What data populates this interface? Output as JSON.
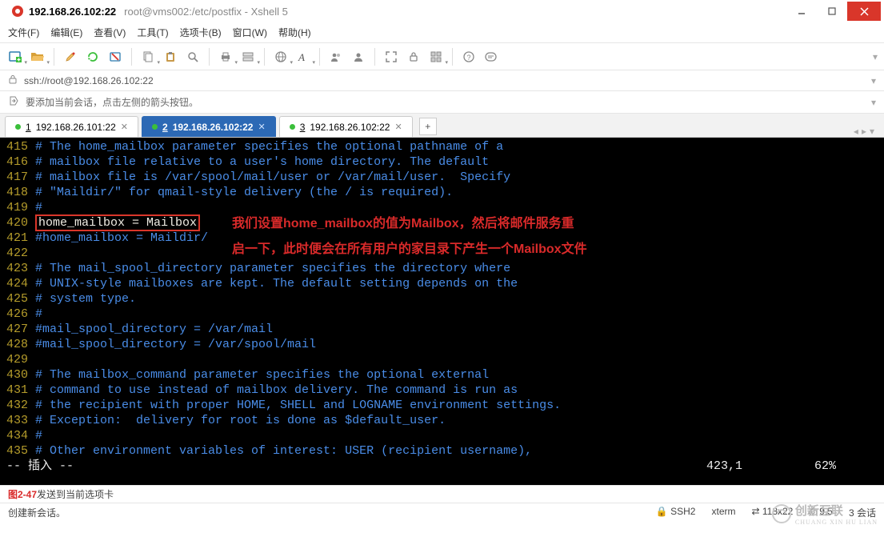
{
  "window": {
    "title_main": "192.168.26.102:22",
    "title_sub": "root@vms002:/etc/postfix - Xshell 5"
  },
  "menu": {
    "file": "文件(F)",
    "edit": "编辑(E)",
    "view": "查看(V)",
    "tools": "工具(T)",
    "tabs": "选项卡(B)",
    "window": "窗口(W)",
    "help": "帮助(H)"
  },
  "address": {
    "url": "ssh://root@192.168.26.102:22"
  },
  "hint": "要添加当前会话，点击左侧的箭头按钮。",
  "tabs": [
    {
      "num": "1",
      "label": "192.168.26.101:22",
      "active": false
    },
    {
      "num": "2",
      "label": "192.168.26.102:22",
      "active": true
    },
    {
      "num": "3",
      "label": "192.168.26.102:22",
      "active": false
    }
  ],
  "terminal": {
    "lines": [
      {
        "no": "415",
        "text": "# The home_mailbox parameter specifies the optional pathname of a",
        "cls": "cm"
      },
      {
        "no": "416",
        "text": "# mailbox file relative to a user's home directory. The default",
        "cls": "cm"
      },
      {
        "no": "417",
        "text": "# mailbox file is /var/spool/mail/user or /var/mail/user.  Specify",
        "cls": "cm"
      },
      {
        "no": "418",
        "text": "# \"Maildir/\" for qmail-style delivery (the / is required).",
        "cls": "cm"
      },
      {
        "no": "419",
        "text": "#",
        "cls": "cm"
      },
      {
        "no": "420",
        "text": "home_mailbox = Mailbox",
        "cls": "sp",
        "hi": true
      },
      {
        "no": "421",
        "text": "#home_mailbox = Maildir/",
        "cls": "cm"
      },
      {
        "no": "422",
        "text": "",
        "cls": "cm"
      },
      {
        "no": "423",
        "text": "# The mail_spool_directory parameter specifies the directory where",
        "cls": "cm"
      },
      {
        "no": "424",
        "text": "# UNIX-style mailboxes are kept. The default setting depends on the",
        "cls": "cm"
      },
      {
        "no": "425",
        "text": "# system type.",
        "cls": "cm"
      },
      {
        "no": "426",
        "text": "#",
        "cls": "cm"
      },
      {
        "no": "427",
        "text": "#mail_spool_directory = /var/mail",
        "cls": "cm"
      },
      {
        "no": "428",
        "text": "#mail_spool_directory = /var/spool/mail",
        "cls": "cm"
      },
      {
        "no": "429",
        "text": "",
        "cls": "cm"
      },
      {
        "no": "430",
        "text": "# The mailbox_command parameter specifies the optional external",
        "cls": "cm"
      },
      {
        "no": "431",
        "text": "# command to use instead of mailbox delivery. The command is run as",
        "cls": "cm"
      },
      {
        "no": "432",
        "text": "# the recipient with proper HOME, SHELL and LOGNAME environment settings.",
        "cls": "cm"
      },
      {
        "no": "433",
        "text": "# Exception:  delivery for root is done as $default_user.",
        "cls": "cm"
      },
      {
        "no": "434",
        "text": "#",
        "cls": "cm"
      },
      {
        "no": "435",
        "text": "# Other environment variables of interest: USER (recipient username),",
        "cls": "cm"
      }
    ],
    "mode": "-- 插入 --",
    "pos": "423,1",
    "pct": "62%",
    "annotation1": "我们设置home_mailbox的值为Mailbox，然后将邮件服务重",
    "annotation2": "启一下，此时便会在所有用户的家目录下产生一个Mailbox文件"
  },
  "footer1": {
    "figlabel": "图2-47",
    "rest": "发送到当前选项卡"
  },
  "footer2": {
    "left": "创建新会话。",
    "ssh": "SSH2",
    "term": "xterm",
    "size": "118x22",
    "cap": "9,5",
    "sessions": "3 会话"
  },
  "watermark": {
    "cn": "创新互联",
    "en": "CHUANG XIN HU LIAN"
  }
}
